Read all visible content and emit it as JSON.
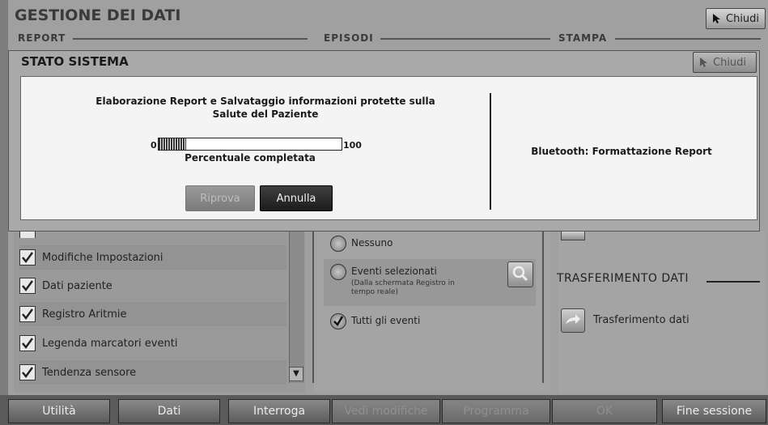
{
  "window": {
    "title": "GESTIONE DEI DATI",
    "close_label": "Chiudi"
  },
  "sections": {
    "report": "REPORT",
    "episodi": "EPISODI",
    "stampa": "STAMPA"
  },
  "report_options": [
    {
      "label": "Modifiche Impostazioni",
      "checked": true
    },
    {
      "label": "Dati paziente",
      "checked": true
    },
    {
      "label": "Registro Aritmie",
      "checked": true
    },
    {
      "label": "Legenda marcatori eventi",
      "checked": true
    },
    {
      "label": "Tendenza sensore",
      "checked": true
    }
  ],
  "episodes": {
    "none_label": "Nessuno",
    "selected_label": "Eventi selezionati",
    "selected_sub": "(Dalla schermata Registro in tempo reale)",
    "all_label": "Tutti gli eventi",
    "selected_value": "Tutti gli eventi"
  },
  "transfer": {
    "title": "TRASFERIMENTO DATI",
    "button_label": "Trasferimento dati"
  },
  "bottom_nav": [
    {
      "label": "Utilità",
      "enabled": true
    },
    {
      "label": "Dati",
      "enabled": true
    },
    {
      "label": "Interroga",
      "enabled": true
    },
    {
      "label": "Vedi modifiche",
      "enabled": false
    },
    {
      "label": "Programma",
      "enabled": false
    },
    {
      "label": "OK",
      "enabled": false
    },
    {
      "label": "Fine sessione",
      "enabled": true
    }
  ],
  "modal": {
    "title": "STATO SISTEMA",
    "close_label": "Chiudi",
    "message": "Elaborazione Report e Salvataggio informazioni protette sulla Salute del Paziente",
    "progress_min": "0",
    "progress_max": "100",
    "progress_fraction": 0.15,
    "progress_label": "Percentuale completata",
    "status": "Bluetooth: Formattazione Report",
    "retry_label": "Riprova",
    "cancel_label": "Annulla"
  },
  "icons": {
    "close": "cursor-arrow-icon",
    "checkbox": "check-icon",
    "zoom": "magnifier-icon",
    "transfer": "arrow-right-icon"
  }
}
